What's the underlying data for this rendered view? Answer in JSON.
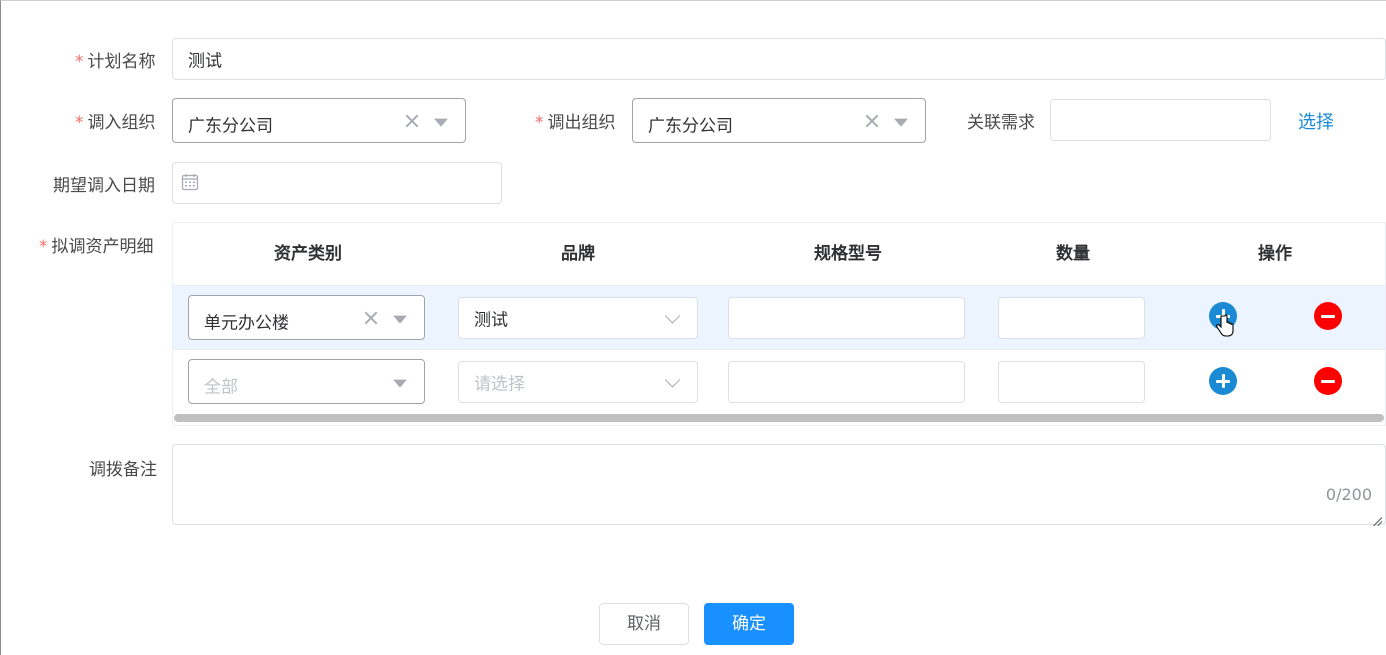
{
  "form": {
    "plan_name": {
      "label": "计划名称",
      "required_mark": "*",
      "value": "测试"
    },
    "in_org": {
      "label": "调入组织",
      "required_mark": "*",
      "value": "广东分公司"
    },
    "out_org": {
      "label": "调出组织",
      "required_mark": "*",
      "value": "广东分公司"
    },
    "related_demand": {
      "label": "关联需求",
      "value": "",
      "select_link": "选择"
    },
    "expected_date": {
      "label": "期望调入日期",
      "value": ""
    },
    "asset_details": {
      "label": "拟调资产明细",
      "required_mark": "*"
    },
    "remark": {
      "label": "调拨备注",
      "value": "",
      "counter": "0/200"
    }
  },
  "table": {
    "columns": [
      "资产类别",
      "品牌",
      "规格型号",
      "数量",
      "操作"
    ],
    "rows": [
      {
        "category": "单元办公楼",
        "category_placeholder": "",
        "brand": "测试",
        "brand_placeholder": "",
        "spec": "",
        "qty": ""
      },
      {
        "category": "",
        "category_placeholder": "全部",
        "brand": "",
        "brand_placeholder": "请选择",
        "spec": "",
        "qty": ""
      }
    ]
  },
  "footer": {
    "cancel_label": "取消",
    "confirm_label": "确定"
  },
  "colors": {
    "primary": "#1890ff",
    "link": "#1a8bd8",
    "required": "#f56c6c",
    "add_button": "#1a8ad4",
    "remove_button": "#ff0000",
    "row_highlight": "#ecf5ff"
  },
  "icons": {
    "clear": "close-icon",
    "dropdown": "caret-down-icon",
    "date": "calendar-icon",
    "add": "plus-circle-icon",
    "remove": "minus-circle-icon"
  }
}
